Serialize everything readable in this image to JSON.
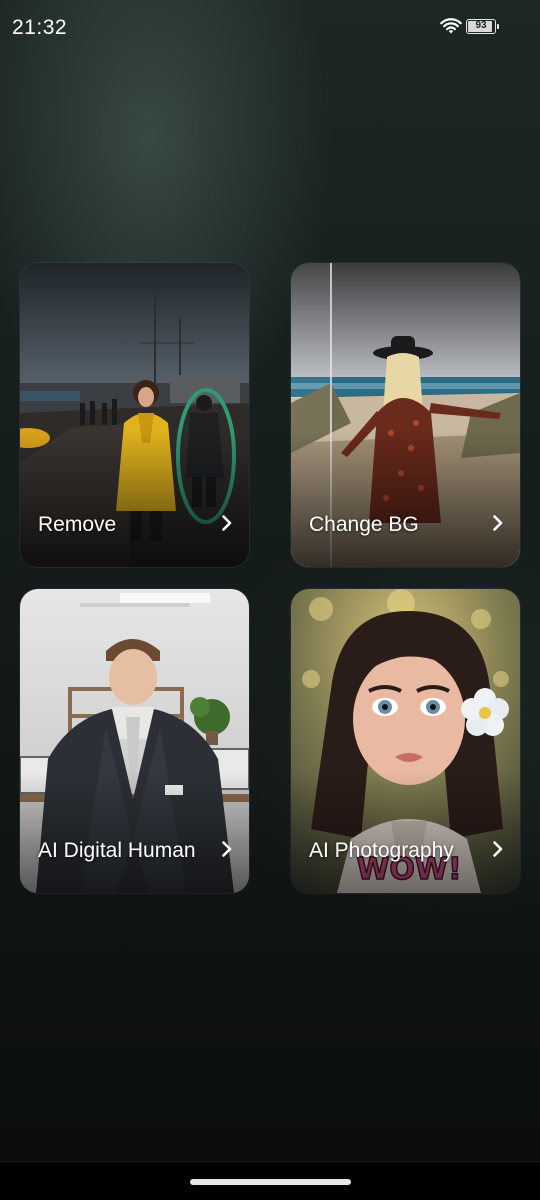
{
  "status_bar": {
    "time": "21:32",
    "battery_level": "93",
    "icons": [
      "wifi-icon",
      "battery-icon"
    ]
  },
  "cards": [
    {
      "id": "remove",
      "label": "Remove",
      "icon": "chevron-right-icon"
    },
    {
      "id": "change-bg",
      "label": "Change BG",
      "icon": "chevron-right-icon"
    },
    {
      "id": "digital-human",
      "label": "AI Digital Human",
      "icon": "chevron-right-icon"
    },
    {
      "id": "photography",
      "label": "AI Photography",
      "icon": "chevron-right-icon"
    }
  ],
  "images": {
    "remove": "harbor-woman-yellow-raincoat",
    "change_bg": "woman-hat-beach",
    "digital_human": "man-suit-office",
    "photography": "illustrated-woman-flower-wow"
  },
  "colors": {
    "accent_highlight": "#2f9a74",
    "background_top": "#1d2725",
    "background_bottom": "#0b0d0d"
  }
}
